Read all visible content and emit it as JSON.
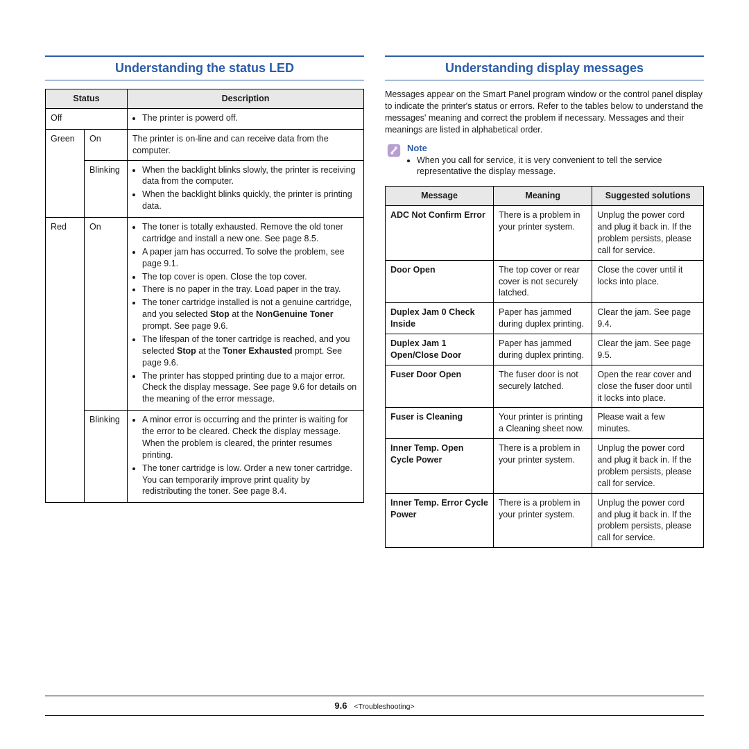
{
  "left": {
    "heading": "Understanding the status LED",
    "table": {
      "head_status": "Status",
      "head_desc": "Description",
      "rows": {
        "off_label": "Off",
        "off_desc": "The printer is powerd off.",
        "green_label": "Green",
        "green_on": "On",
        "green_on_desc": "The printer is on-line and can receive data from the computer.",
        "green_blink": "Blinking",
        "green_blink_b1": "When the backlight blinks slowly, the printer is receiving data from the computer.",
        "green_blink_b2": "When the backlight blinks quickly, the printer is printing data.",
        "red_label": "Red",
        "red_on": "On",
        "red_on_b1": "The toner is totally exhausted. Remove the old toner cartridge and install a new one. See page 8.5.",
        "red_on_b2": "A paper jam has occurred. To solve the problem, see page 9.1.",
        "red_on_b3": "The top cover is open. Close the top cover.",
        "red_on_b4": "There is no paper in the tray. Load paper in the tray.",
        "red_on_b5a": "The toner cartridge installed is not a genuine cartridge, and you selected ",
        "red_on_b5_stop": "Stop",
        "red_on_b5b": " at the ",
        "red_on_b5_ngt": "NonGenuine Toner",
        "red_on_b5c": " prompt. See  page 9.6.",
        "red_on_b6a": "The lifespan of the toner cartridge is reached, and you selected ",
        "red_on_b6_stop": "Stop",
        "red_on_b6b": " at the ",
        "red_on_b6_te": "Toner Exhausted",
        "red_on_b6c": " prompt. See  page 9.6.",
        "red_on_b7": "The printer has stopped printing due to a major error. Check the display message. See page 9.6 for details on the meaning of the error message.",
        "red_blink": "Blinking",
        "red_blink_b1": "A minor error is occurring and the printer is waiting for the error to be cleared. Check the display message. When the problem is cleared, the printer resumes printing.",
        "red_blink_b2": "The toner cartridge is low. Order a new toner cartridge. You can temporarily improve print quality by redistributing the toner. See page 8.4."
      }
    }
  },
  "right": {
    "heading": "Understanding display messages",
    "intro": "Messages appear on the Smart Panel program window or the control panel display to indicate the printer's status or errors. Refer to the tables below to understand the messages' meaning and correct the problem if necessary. Messages and their meanings are listed in alphabetical order.",
    "note": {
      "title": "Note",
      "body": "When you call for service, it is very convenient to tell the service representative the display message."
    },
    "table": {
      "head_msg": "Message",
      "head_meaning": "Meaning",
      "head_solution": "Suggested solutions",
      "rows": [
        {
          "msg": "ADC Not Confirm Error",
          "meaning": "There is a problem in your printer system.",
          "solution": "Unplug the power cord and plug it back in. If the problem persists, please call for service."
        },
        {
          "msg": "Door Open",
          "meaning": "The top cover or rear cover is not securely latched.",
          "solution": "Close the cover until it locks into place."
        },
        {
          "msg": "Duplex Jam 0 Check Inside",
          "meaning": "Paper has jammed during duplex printing.",
          "solution": "Clear the jam. See page 9.4."
        },
        {
          "msg": "Duplex Jam 1 Open/Close Door",
          "meaning": "Paper has jammed during duplex printing.",
          "solution": "Clear the jam. See page 9.5."
        },
        {
          "msg": "Fuser Door Open",
          "meaning": "The fuser door is not securely latched.",
          "solution": "Open the rear cover and close the fuser door until it locks into place."
        },
        {
          "msg": "Fuser is Cleaning",
          "meaning": "Your printer is printing a Cleaning sheet now.",
          "solution": "Please wait a few minutes."
        },
        {
          "msg": "Inner Temp. Open Cycle Power",
          "meaning": "There is a problem in your printer system.",
          "solution": "Unplug the power cord and plug it back in. If the problem persists, please call for service."
        },
        {
          "msg": "Inner Temp. Error Cycle Power",
          "meaning": "There is a problem in your printer system.",
          "solution": "Unplug the power cord and plug it back in. If the problem persists, please call for service."
        }
      ]
    }
  },
  "footer": {
    "page_no": "9.6",
    "crumb": "<Troubleshooting>"
  }
}
